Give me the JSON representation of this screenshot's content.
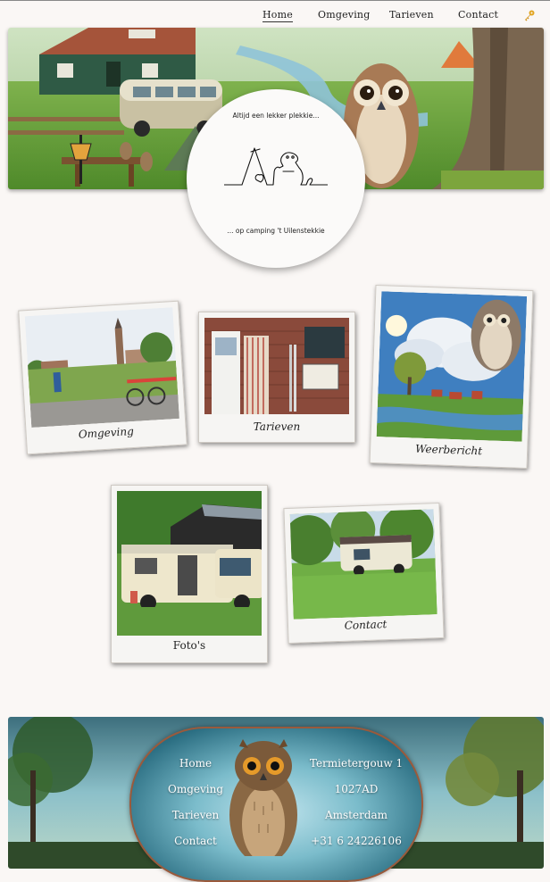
{
  "nav": {
    "items": [
      "Home",
      "Omgeving",
      "Tarieven",
      "Contact"
    ],
    "active": "Home",
    "icon": "key-icon"
  },
  "hero": {
    "tagline_top": "Altijd een lekker plekkie...",
    "tagline_bottom": "... op camping 't Uilenstekkie"
  },
  "cards": [
    {
      "caption": "Omgeving"
    },
    {
      "caption": "Tarieven"
    },
    {
      "caption": "Weerbericht"
    },
    {
      "caption": "Foto's"
    },
    {
      "caption": "Contact"
    }
  ],
  "footer": {
    "nav": [
      "Home",
      "Omgeving",
      "Tarieven",
      "Contact"
    ],
    "address": [
      "Termietergouw 1",
      "1027AD",
      "Amsterdam",
      "+31 6 24226106"
    ]
  }
}
